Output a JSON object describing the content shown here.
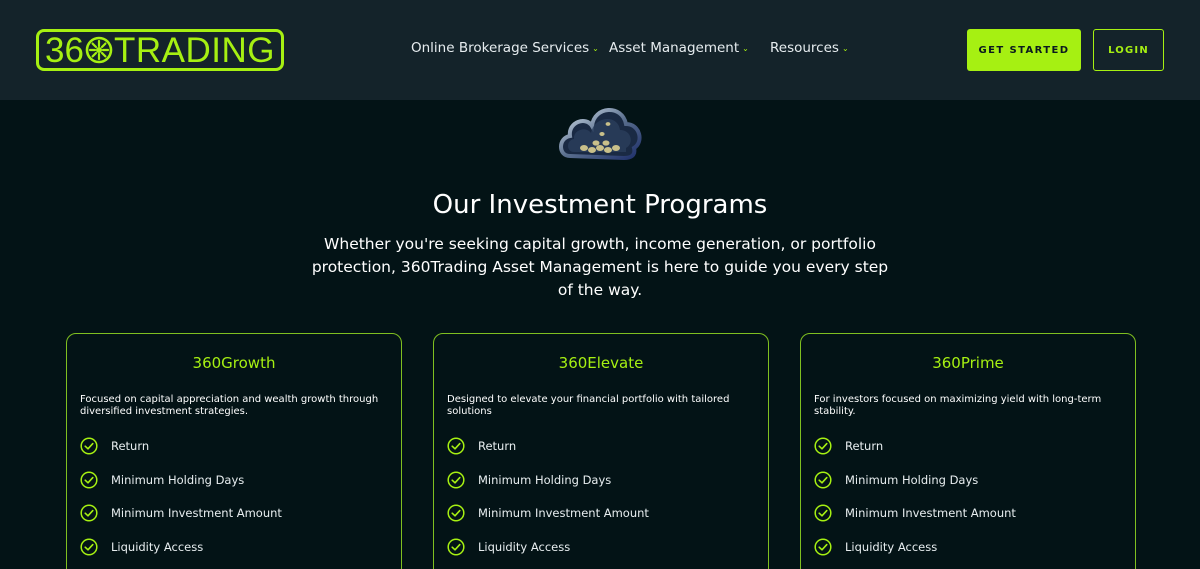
{
  "header": {
    "logo": {
      "prefix": "36",
      "suffix": "TRADING"
    },
    "nav": [
      {
        "label": "Online Brokerage Services"
      },
      {
        "label": "Asset Management"
      },
      {
        "label": "Resources"
      }
    ],
    "get_started": "GET STARTED",
    "login": "LOGIN"
  },
  "hero": {
    "title": "Our Investment Programs",
    "subtitle": "Whether you're seeking capital growth, income generation, or portfolio protection, 360Trading Asset Management is here to guide you every step of the way."
  },
  "programs": [
    {
      "name": "360Growth",
      "description": "Focused on capital appreciation and wealth growth through diversified investment strategies.",
      "features": [
        "Return",
        "Minimum Holding Days",
        "Minimum Investment Amount",
        "Liquidity Access"
      ]
    },
    {
      "name": "360Elevate",
      "description": "Designed to elevate your financial portfolio with tailored solutions",
      "features": [
        "Return",
        "Minimum Holding Days",
        "Minimum Investment Amount",
        "Liquidity Access"
      ]
    },
    {
      "name": "360Prime",
      "description": "For investors focused on maximizing yield with long-term stability.",
      "features": [
        "Return",
        "Minimum Holding Days",
        "Minimum Investment Amount",
        "Liquidity Access"
      ]
    }
  ],
  "colors": {
    "accent": "#a6f012",
    "background": "#031316",
    "header": "#14232a"
  },
  "icons": {
    "logo_zero": "sun-icon",
    "nav_dropdown": "chevron-down-icon",
    "feature": "check-circle-icon",
    "hero": "cloud-coins-icon"
  }
}
